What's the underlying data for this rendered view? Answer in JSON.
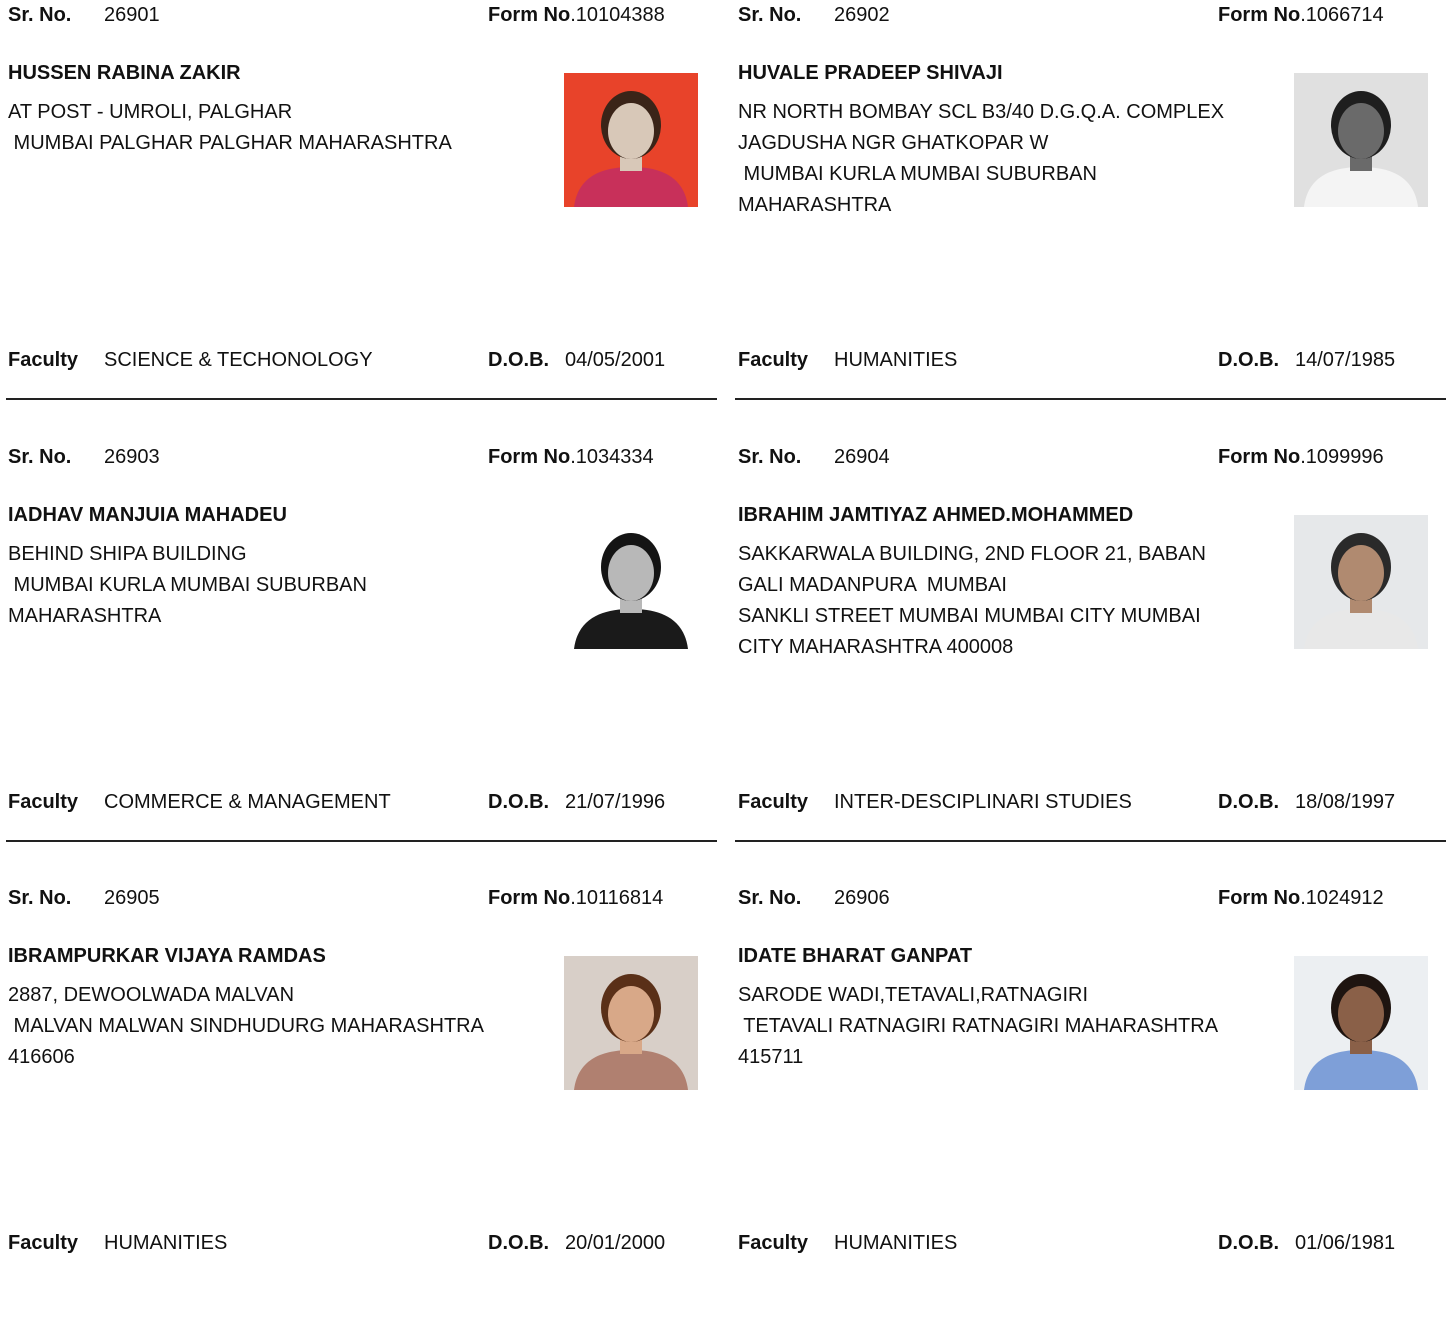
{
  "labels": {
    "sr_no": "Sr. No.",
    "form_no": "Form No",
    "faculty": "Faculty",
    "dob": "D.O.B."
  },
  "records": [
    {
      "sr_no": "26901",
      "form_no": ".10104388",
      "name": "HUSSEN RABINA ZAKIR",
      "address": "AT POST - UMROLI, PALGHAR\n MUMBAI PALGHAR PALGHAR MAHARASHTRA",
      "faculty": "SCIENCE & TECHONOLOGY",
      "dob": "04/05/2001",
      "photo": "female-portrait-red-background"
    },
    {
      "sr_no": "26902",
      "form_no": ".1066714",
      "name": "HUVALE PRADEEP SHIVAJI",
      "address": "NR NORTH BOMBAY SCL B3/40 D.G.Q.A. COMPLEX\nJAGDUSHA NGR GHATKOPAR W\n MUMBAI KURLA MUMBAI SUBURBAN\nMAHARASHTRA",
      "faculty": "HUMANITIES",
      "dob": "14/07/1985",
      "photo": "male-portrait-grayscale"
    },
    {
      "sr_no": "26903",
      "form_no": ".1034334",
      "name": "IADHAV MANJUIA MAHADEU",
      "address": "BEHIND SHIPA BUILDING\n MUMBAI KURLA MUMBAI SUBURBAN\nMAHARASHTRA",
      "faculty": "COMMERCE & MANAGEMENT",
      "dob": "21/07/1996",
      "photo": "female-portrait-black-white"
    },
    {
      "sr_no": "26904",
      "form_no": ".1099996",
      "name": "IBRAHIM JAMTIYAZ AHMED.MOHAMMED",
      "address": "SAKKARWALA BUILDING, 2ND FLOOR 21, BABAN\nGALI MADANPURA  MUMBAI\nSANKLI STREET MUMBAI MUMBAI CITY MUMBAI\nCITY MAHARASHTRA 400008",
      "faculty": "INTER-DESCIPLINARI STUDIES",
      "dob": "18/08/1997",
      "photo": "male-portrait-beard-glasses"
    },
    {
      "sr_no": "26905",
      "form_no": ".10116814",
      "name": "IBRAMPURKAR VIJAYA RAMDAS",
      "address": "2887, DEWOOLWADA MALVAN\n MALVAN MALWAN SINDHUDURG MAHARASHTRA\n416606",
      "faculty": "HUMANITIES",
      "dob": "20/01/2000",
      "photo": "female-portrait-smiling"
    },
    {
      "sr_no": "26906",
      "form_no": ".1024912",
      "name": "IDATE BHARAT GANPAT",
      "address": "SARODE WADI,TETAVALI,RATNAGIRI\n TETAVALI RATNAGIRI RATNAGIRI MAHARASHTRA\n415711",
      "faculty": "HUMANITIES",
      "dob": "01/06/1981",
      "photo": "male-portrait-blue-shirt"
    }
  ]
}
